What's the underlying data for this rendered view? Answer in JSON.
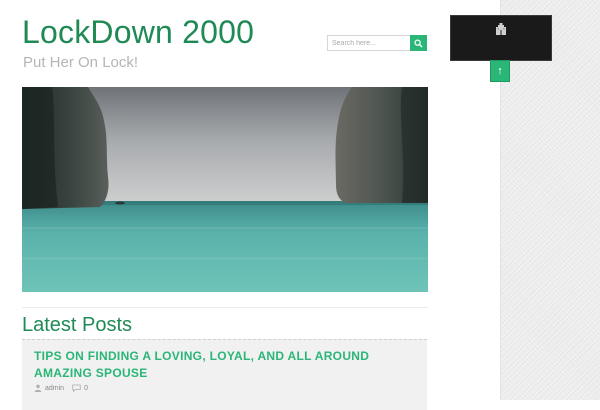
{
  "header": {
    "site_title": "LockDown 2000",
    "tagline": "Put Her On Lock!"
  },
  "search": {
    "placeholder": "Search here...",
    "button_icon": "search-icon"
  },
  "main": {
    "section_title": "Latest Posts",
    "posts": [
      {
        "title": "TIPS ON FINDING A LOVING, LOYAL, AND ALL AROUND AMAZING SPOUSE",
        "author": "admin",
        "comments": "0"
      }
    ]
  },
  "sidebar": {
    "widget_icon": "castle-icon",
    "back_to_top_icon": "arrow-up-icon"
  },
  "colors": {
    "brand_green": "#1f8a55",
    "accent_green": "#2ab676",
    "tagline_gray": "#b5b5b5"
  }
}
